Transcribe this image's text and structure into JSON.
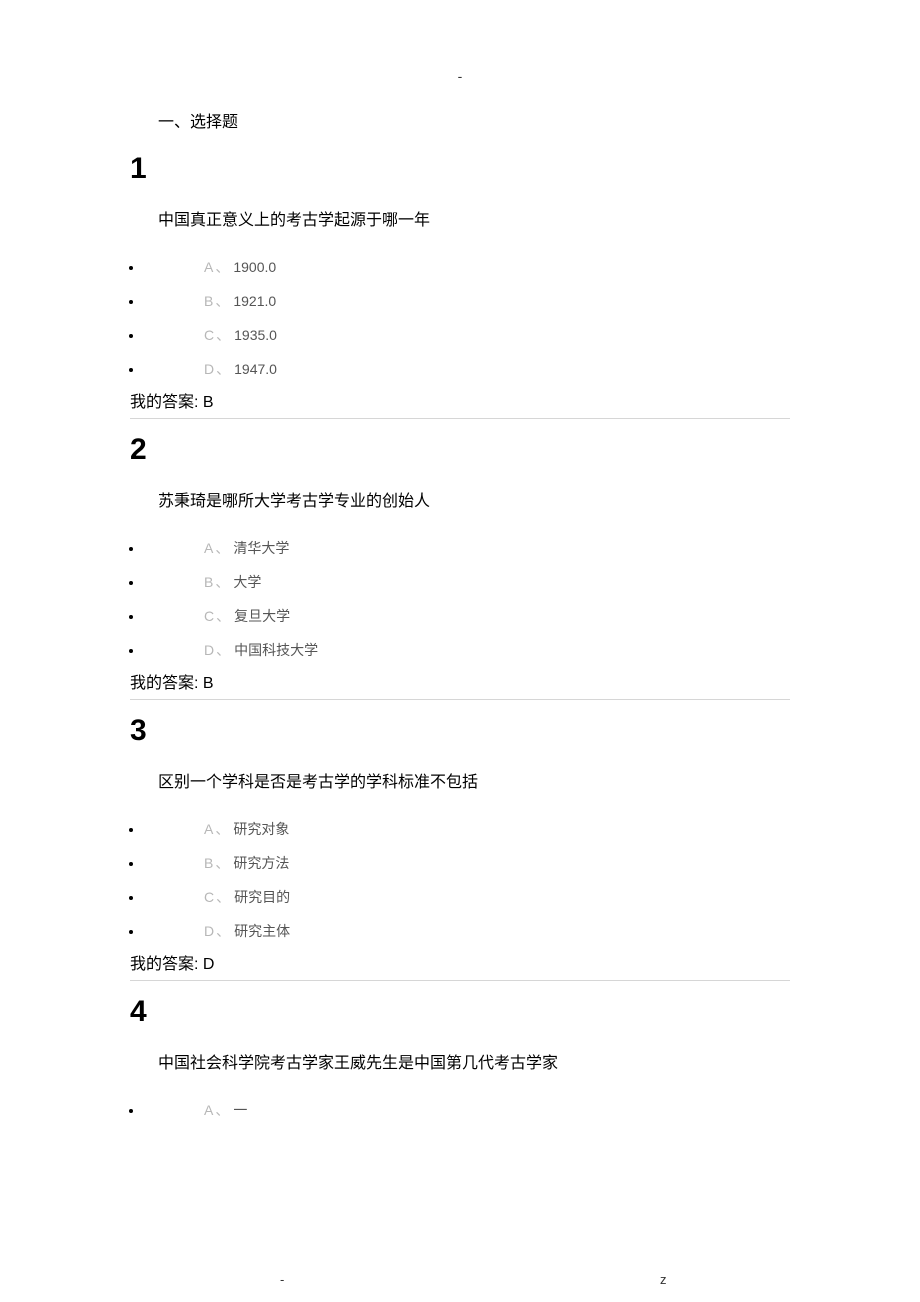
{
  "page_top_mark": "-",
  "section_title": "一、选择题",
  "questions": [
    {
      "number": "1",
      "text": "中国真正意义上的考古学起源于哪一年",
      "options": [
        {
          "letter": "A",
          "value": "1900.0"
        },
        {
          "letter": "B",
          "value": "1921.0"
        },
        {
          "letter": "C",
          "value": "1935.0"
        },
        {
          "letter": "D",
          "value": "1947.0"
        }
      ],
      "answer_label": "我的答案:",
      "answer_value": "B",
      "has_divider": true
    },
    {
      "number": "2",
      "text": "苏秉琦是哪所大学考古学专业的创始人",
      "options": [
        {
          "letter": "A",
          "value": "清华大学"
        },
        {
          "letter": "B",
          "value": "大学"
        },
        {
          "letter": "C",
          "value": "复旦大学"
        },
        {
          "letter": "D",
          "value": "中国科技大学"
        }
      ],
      "answer_label": "我的答案:",
      "answer_value": "B",
      "has_divider": true
    },
    {
      "number": "3",
      "text": "区别一个学科是否是考古学的学科标准不包括",
      "options": [
        {
          "letter": "A",
          "value": "研究对象"
        },
        {
          "letter": "B",
          "value": "研究方法"
        },
        {
          "letter": "C",
          "value": "研究目的"
        },
        {
          "letter": "D",
          "value": "研究主体"
        }
      ],
      "answer_label": "我的答案:",
      "answer_value": "D",
      "has_divider": true
    },
    {
      "number": "4",
      "text": "中国社会科学院考古学家王威先生是中国第几代考古学家",
      "options": [
        {
          "letter": "A",
          "value": "一"
        }
      ],
      "answer_label": "",
      "answer_value": "",
      "has_divider": false
    }
  ],
  "option_separator": "、",
  "footer_dash": "-",
  "footer_z": "z"
}
